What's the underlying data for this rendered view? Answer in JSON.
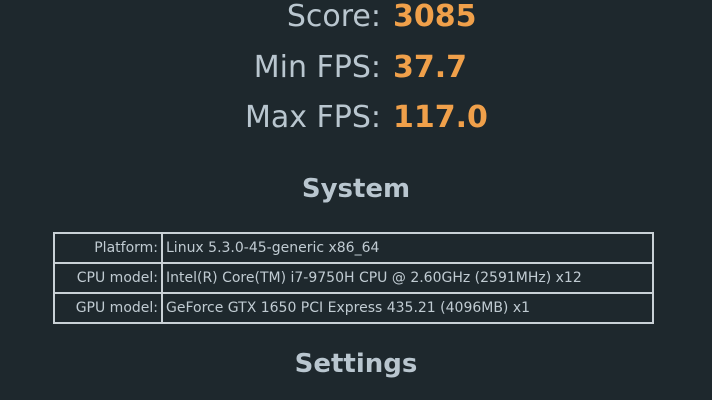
{
  "stats": {
    "score": {
      "label": "Score:",
      "value": "3085"
    },
    "min_fps": {
      "label": "Min FPS:",
      "value": "37.7"
    },
    "max_fps": {
      "label": "Max FPS:",
      "value": "117.0"
    }
  },
  "system": {
    "heading": "System",
    "rows": [
      {
        "key": "Platform:",
        "value": "Linux 5.3.0-45-generic x86_64"
      },
      {
        "key": "CPU model:",
        "value": "Intel(R) Core(TM) i7-9750H CPU @ 2.60GHz (2591MHz) x12"
      },
      {
        "key": "GPU model:",
        "value": "GeForce GTX 1650 PCI Express 435.21 (4096MB) x1"
      }
    ]
  },
  "settings": {
    "heading": "Settings"
  },
  "colors": {
    "background": "#1e282d",
    "label_text": "#b9c6cf",
    "value_accent": "#f0a04a",
    "table_border": "#c9d1d6"
  }
}
